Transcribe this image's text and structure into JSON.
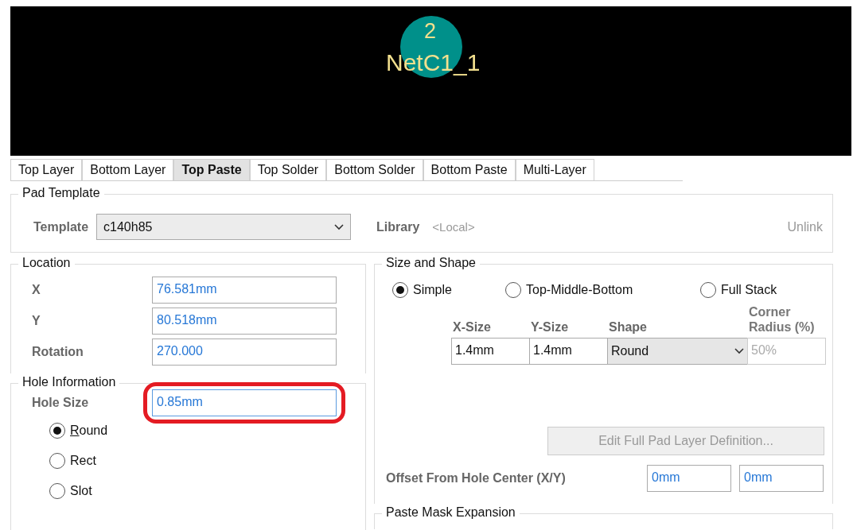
{
  "preview": {
    "pad_number": "2",
    "net_name": "NetC1_1"
  },
  "tabs": [
    {
      "label": "Top Layer",
      "selected": false
    },
    {
      "label": "Bottom Layer",
      "selected": false
    },
    {
      "label": "Top Paste",
      "selected": true
    },
    {
      "label": "Top Solder",
      "selected": false
    },
    {
      "label": "Bottom Solder",
      "selected": false
    },
    {
      "label": "Bottom Paste",
      "selected": false
    },
    {
      "label": "Multi-Layer",
      "selected": false
    }
  ],
  "pad_template": {
    "title": "Pad Template",
    "template_label": "Template",
    "template_value": "c140h85",
    "library_label": "Library",
    "library_value": "<Local>",
    "unlink": "Unlink"
  },
  "location": {
    "title": "Location",
    "fields": [
      {
        "label": "X",
        "value": "76.581mm"
      },
      {
        "label": "Y",
        "value": "80.518mm"
      },
      {
        "label": "Rotation",
        "value": "270.000"
      }
    ]
  },
  "hole_information": {
    "title": "Hole Information",
    "hole_size_label": "Hole Size",
    "hole_size_value": "0.85mm",
    "highlighted": true,
    "shapes": [
      {
        "label": "Round",
        "selected": true,
        "underline_first_letter": true
      },
      {
        "label": "Rect",
        "selected": false
      },
      {
        "label": "Slot",
        "selected": false
      }
    ]
  },
  "size_and_shape": {
    "title": "Size and Shape",
    "modes": [
      {
        "label": "Simple",
        "selected": true
      },
      {
        "label": "Top-Middle-Bottom",
        "selected": false
      },
      {
        "label": "Full Stack",
        "selected": false
      }
    ],
    "columns": [
      "X-Size",
      "Y-Size",
      "Shape",
      "Corner Radius (%)"
    ],
    "row": {
      "x_size": "1.4mm",
      "y_size": "1.4mm",
      "shape": "Round",
      "corner_radius": "50%"
    },
    "edit_button": {
      "label": "Edit Full Pad Layer Definition...",
      "disabled": true
    },
    "offset_label": "Offset From Hole Center (X/Y)",
    "offset_x": "0mm",
    "offset_y": "0mm"
  },
  "paste_mask": {
    "title": "Paste Mask Expansion"
  }
}
